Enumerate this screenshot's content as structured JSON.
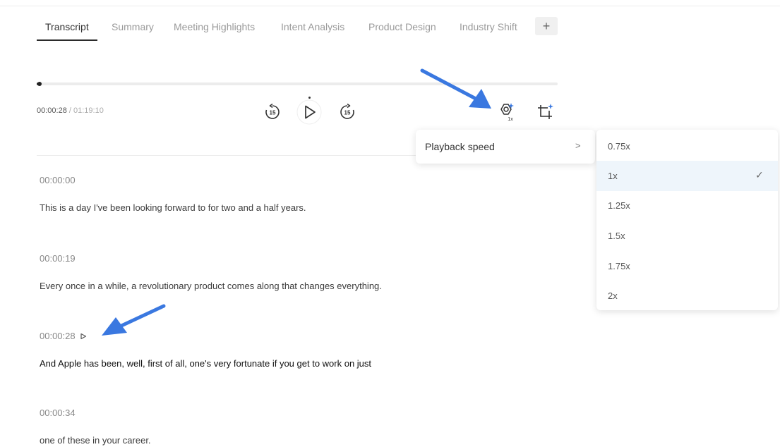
{
  "tabs": [
    {
      "label": "Transcript",
      "active": true
    },
    {
      "label": "Summary",
      "active": false
    },
    {
      "label": "Meeting Highlights",
      "active": false
    },
    {
      "label": "Intent Analysis",
      "active": false
    },
    {
      "label": "Product Design",
      "active": false
    },
    {
      "label": "Industry Shift",
      "active": false
    }
  ],
  "add_tab_label": "+",
  "player": {
    "current_time": "00:00:28",
    "separator": "/",
    "total_time": "01:19:10",
    "progress_fraction": 0.006,
    "rewind_label": "15",
    "forward_label": "15",
    "speed_badge": "1x"
  },
  "menu": {
    "playback_speed_label": "Playback speed",
    "chevron": ">"
  },
  "speed_options": [
    {
      "label": "0.75x",
      "selected": false
    },
    {
      "label": "1x",
      "selected": true
    },
    {
      "label": "1.25x",
      "selected": false
    },
    {
      "label": "1.5x",
      "selected": false
    },
    {
      "label": "1.75x",
      "selected": false
    },
    {
      "label": "2x",
      "selected": false
    }
  ],
  "check_mark": "✓",
  "transcript": [
    {
      "time": "00:00:00",
      "text": "This is a day I've been looking forward to for two and a half years.",
      "playing": false
    },
    {
      "time": "00:00:19",
      "text": "Every once in a while, a revolutionary product comes along that changes everything.",
      "playing": false
    },
    {
      "time": "00:00:28",
      "text": "And Apple has been, well, first of all, one's very fortunate if you get to work on just",
      "playing": true
    },
    {
      "time": "00:00:34",
      "text": "one of these in your career.",
      "playing": false
    }
  ],
  "colors": {
    "accent_arrow": "#3a78e0",
    "selected_row": "#eef5fb"
  }
}
